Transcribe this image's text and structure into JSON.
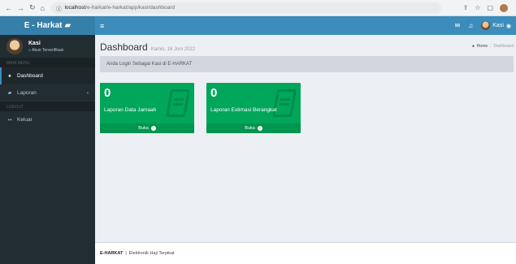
{
  "browser": {
    "url_host": "localhost",
    "url_path": "/e-harkat/e-harkat/app/kasi/dashboard"
  },
  "app": {
    "logo_text": "E - Harkat"
  },
  "topbar": {
    "user_name": "Kasi"
  },
  "sidebar": {
    "user_name": "Kasi",
    "user_status": "Akun Terverifikasi",
    "main_menu_header": "MAIN MENU",
    "items": [
      {
        "label": "Dashboard",
        "icon": "home-icon"
      },
      {
        "label": "Laporan",
        "icon": "book-icon"
      }
    ],
    "logout_header": "LOGOUT",
    "logout_label": "Keluar"
  },
  "content": {
    "title": "Dashboard",
    "subtitle": "Kamis, 16 Juni 2022",
    "breadcrumb_home": "Home",
    "breadcrumb_current": "Dashboard",
    "callout_text": "Anda Login Sebagai Kasi di E-HARKAT",
    "boxes": [
      {
        "count": "0",
        "label": "Laporan Data Jamaah",
        "footer": "Buka"
      },
      {
        "count": "0",
        "label": "Laporan Estimasi Berangkat",
        "footer": "Buka"
      }
    ]
  },
  "footer": {
    "brand": "E-HARKAT",
    "separator": "|",
    "tagline": "Elektronik Haji Terpikat"
  },
  "colors": {
    "topbar": "#3c8dbc",
    "logo_bar": "#367fa9",
    "sidebar": "#222d32",
    "box_green": "#00a65a"
  }
}
